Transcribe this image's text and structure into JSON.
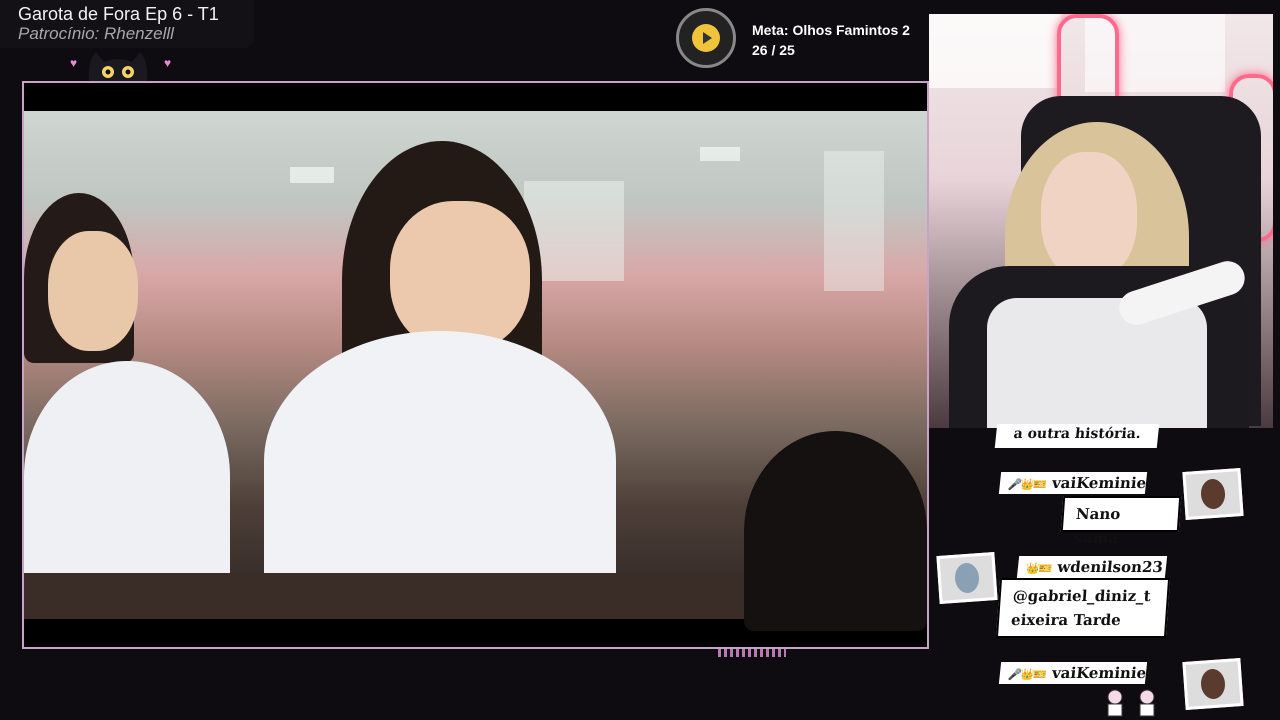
{
  "overlay": {
    "title": "Garota de Fora Ep 6 - T1",
    "sponsor": "Patrocínio: Rhenzelll"
  },
  "goal": {
    "label": "Meta: Olhos Famintos 2",
    "progress": "26 / 25",
    "accent": "#f0c43a"
  },
  "chat": {
    "fragment": "a outra história.",
    "messages": [
      {
        "user": "vaiKeminiel",
        "badges": "🎤👑🎫",
        "text": "Nano sama"
      },
      {
        "user": "wdenilson23",
        "badges": "👑🎫",
        "text": "@gabriel_diniz_teixeira Tarde"
      },
      {
        "user": "vaiKeminiel",
        "badges": "🎤👑🎫",
        "text": ""
      }
    ]
  },
  "colors": {
    "frame_border": "#c9a3c6",
    "neon": "#ff6a8c"
  }
}
